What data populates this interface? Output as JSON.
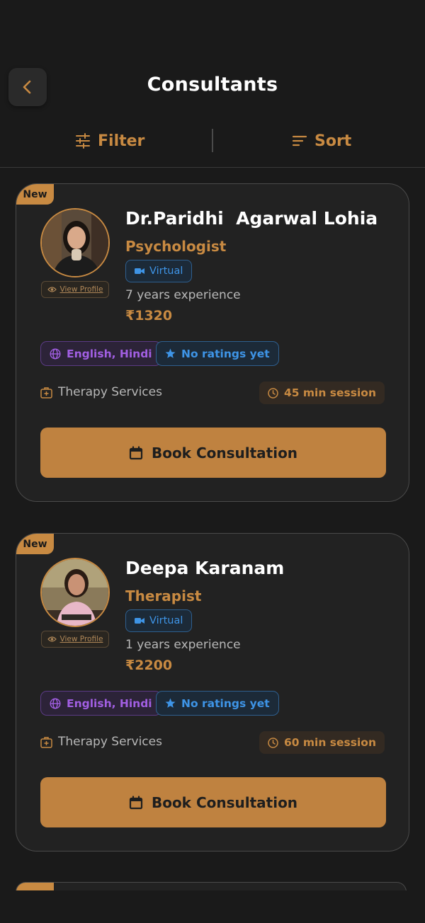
{
  "header": {
    "title": "Consultants"
  },
  "toolbar": {
    "filter_label": "Filter",
    "sort_label": "Sort"
  },
  "colors": {
    "accent": "#c88a42",
    "background": "#1a1a1a",
    "card": "#222222",
    "virtual_blue": "#3e94e6",
    "language_purple": "#a25fe3"
  },
  "consultants": [
    {
      "badge": "New",
      "name": "Dr.Paridhi  Agarwal Lohia",
      "role": "Psychologist",
      "mode": "Virtual",
      "experience": "7 years experience",
      "price": "₹1320",
      "view_profile": "View Profile",
      "languages": "English, Hindi",
      "rating": "No ratings yet",
      "service": "Therapy Services",
      "session": "45 min session",
      "book_label": "Book Consultation"
    },
    {
      "badge": "New",
      "name": "Deepa Karanam",
      "role": "Therapist",
      "mode": "Virtual",
      "experience": "1 years experience",
      "price": "₹2200",
      "view_profile": "View Profile",
      "languages": "English, Hindi",
      "rating": "No ratings yet",
      "service": "Therapy Services",
      "session": "60 min session",
      "book_label": "Book Consultation"
    }
  ]
}
